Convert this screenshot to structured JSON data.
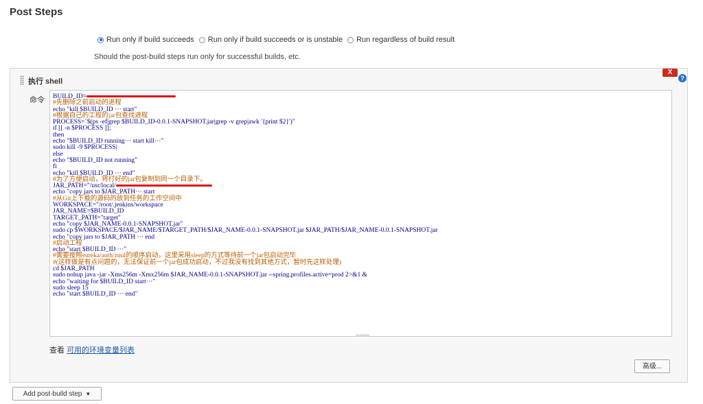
{
  "section": {
    "title": "Post Steps"
  },
  "run_options": {
    "options": [
      {
        "label": "Run only if build succeeds",
        "checked": true
      },
      {
        "label": "Run only if build succeeds or is unstable",
        "checked": false
      },
      {
        "label": "Run regardless of build result",
        "checked": false
      }
    ],
    "hint": "Should the post-build steps run only for successful builds, etc."
  },
  "builder": {
    "title": "执行 shell",
    "delete_label": "X",
    "help_label": "?",
    "command_label": "命令",
    "command_lines": [
      {
        "text": "BUILD_ID=",
        "redact": 130
      },
      {
        "text": "#先删除之前启动的进程",
        "comment": true
      },
      {
        "text": "echo \"kill $BUILD_ID ··· start\""
      },
      {
        "text": "#根据自己的工程的jar包查找进程",
        "comment": true
      },
      {
        "text": "PROCESS=`$(ps -ef|grep $BUILD_ID-0.0.1-SNAPSHOT.jar|grep -v grep|awk '{print $2}')\""
      },
      {
        "text": "if [[ -n $PROCESS ]];"
      },
      {
        "text": "then"
      },
      {
        "text": "echo \"$BUILD_ID running··· start kill···\""
      },
      {
        "text": "sudo kill -9 $PROCESS|"
      },
      {
        "text": "else"
      },
      {
        "text": "echo \"$BUILD_ID not running\""
      },
      {
        "text": "fi"
      },
      {
        "text": "echo \"kill $BUILD_ID ··· end\""
      },
      {
        "text": "#为了方便启动，将打好的jar包复制到同一个目录下。",
        "comment": true
      },
      {
        "text": "JAR_PATH=\"/usr/local/",
        "redact": 140
      },
      {
        "text": "echo \"copy jars to $JAR_PATH··· start"
      },
      {
        "text": "#从Git上下载的源码的放到任务的工作空间中",
        "comment": true
      },
      {
        "text": "WORKSPACE=\"/root/.jenkins/workspace"
      },
      {
        "text": "JAR_NAME=$BUILD_ID"
      },
      {
        "text": "TARGET_PATH=\"target\""
      },
      {
        "text": "echo \"copy $JAR_NAME-0.0.1-SNAPSHOT.jar\""
      },
      {
        "text": "sudo cp $WORKSPACE/$JAR_NAME/$TARGET_PATH/$JAR_NAME-0.0.1-SNAPSHOT.jar $JAR_PATH/$JAR_NAME-0.0.1-SNAPSHOT.jar"
      },
      {
        "text": "echo \"copy jars to $JAR_PATH ··· end"
      },
      {
        "text": "#启动工程",
        "comment": true
      },
      {
        "text": "echo \"start $BUILD_ID ···\""
      },
      {
        "text": "#需要按照eureka/auth/zuul的顺序启动，这里采用sleep的方式等待前一个jar包启动完毕",
        "comment": true
      },
      {
        "text": "#(这样做是有点问题的，无法保证前一个jar包成功启动，不过我没有找到其他方式，暂时先这样处理)",
        "comment": true
      },
      {
        "text": "cd $JAR_PATH"
      },
      {
        "text": "sudo nohup java -jar -Xms256m -Xmx256m $JAR_NAME-0.0.1-SNAPSHOT.jar --spring.profiles.active=prod 2>&1 &"
      },
      {
        "text": "echo \"waiting for $BUILD_ID start···\""
      },
      {
        "text": "sudo sleep 15"
      },
      {
        "text": "echo \"start $BUILD_ID ··· end\""
      }
    ],
    "env_prefix": "查看",
    "env_link": "可用的环境变量列表",
    "advanced_label": "高级..."
  },
  "footer": {
    "add_step_label": "Add post-build step",
    "caret": "▼"
  }
}
